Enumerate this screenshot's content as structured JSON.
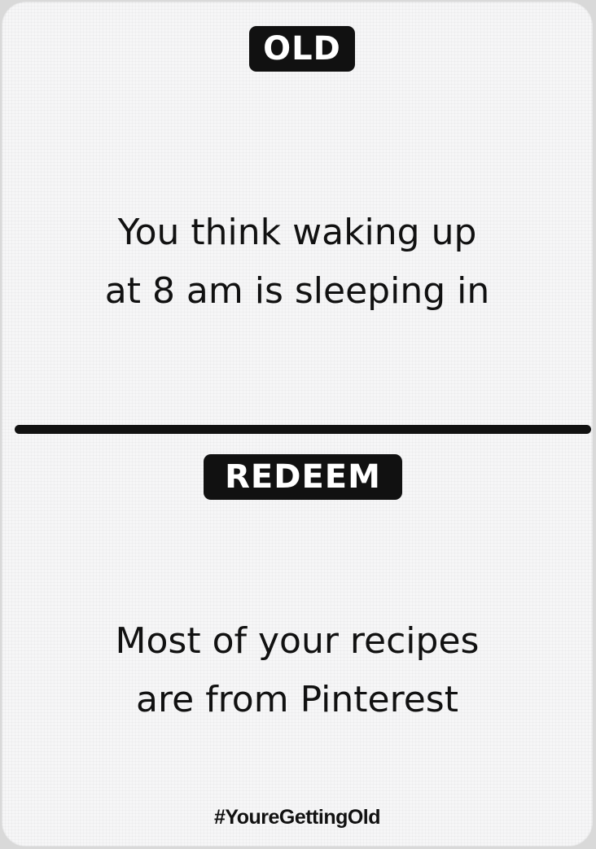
{
  "card": {
    "old_label": "OLD",
    "old_statement_line1": "You think waking up",
    "old_statement_line2": "at 8 am is sleeping in",
    "redeem_label": "REDEEM",
    "redeem_statement_line1": "Most of your recipes",
    "redeem_statement_line2": "are from Pinterest",
    "hashtag": "#YoureGettingOld"
  }
}
